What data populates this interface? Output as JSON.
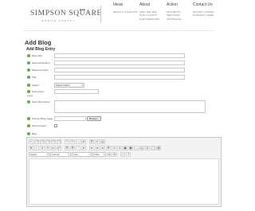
{
  "header": {
    "logo_main": "SIMPSON SQUARE",
    "logo_sub": "MOBILE AGENCY",
    "logo_mark": "◆◆◆",
    "nav": [
      {
        "title": "Ideas",
        "items": [
          "IDEAS & INSIGHTS"
        ]
      },
      {
        "title": "About",
        "items": [
          "WHO WE ARE",
          "OUR CLIENTS",
          "PARTNERSHIPS"
        ]
      },
      {
        "title": "Action",
        "items": [
          "PROJECTS",
          "SERVICES",
          "APPROACH"
        ]
      },
      {
        "title": "Contact Us",
        "items": [
          "INQUIRY FORMS",
          "CONNECT HERE"
        ]
      }
    ]
  },
  "page": {
    "title": "Add Blog",
    "subtitle": "Add Blog Entry"
  },
  "form": {
    "meta_title": "Meta Title",
    "meta_description": "Meta Description",
    "meta_keywords": "Meta Keywords",
    "title": "Title",
    "author": "Author",
    "author_select": "Select Author",
    "date_label_1": "Date (dd-m-",
    "date_label_2": "yyyy)",
    "short_description": "Short Description",
    "primary_image": "Primary Blog Image",
    "browse_button": "Browse...",
    "show_image": "Show Image?",
    "blog": "Blog"
  },
  "editor": {
    "row1": [
      "✂",
      "❐",
      "❐",
      "❐",
      "❐",
      "❐",
      "↶",
      "↷",
      "⌕",
      "⇄",
      "☰",
      "✔",
      "☺"
    ],
    "row2": [
      "B",
      "I",
      "U",
      "S",
      "x₂",
      "x²",
      "☰",
      "☰",
      "“",
      "≡",
      "≡",
      "≡",
      "≡",
      "☰",
      "⚓",
      "⚓",
      "▣",
      "▦",
      "—",
      "☺",
      "Ω",
      "▢",
      "▤"
    ],
    "styles_label": "Styles",
    "format_label": "Format",
    "font_label": "Font",
    "size_label": "Size",
    "extra_buttons": [
      "A",
      "A",
      "⤢",
      "?"
    ]
  },
  "colors": {
    "required_dot": "#6aa84f",
    "heading": "#333333"
  }
}
